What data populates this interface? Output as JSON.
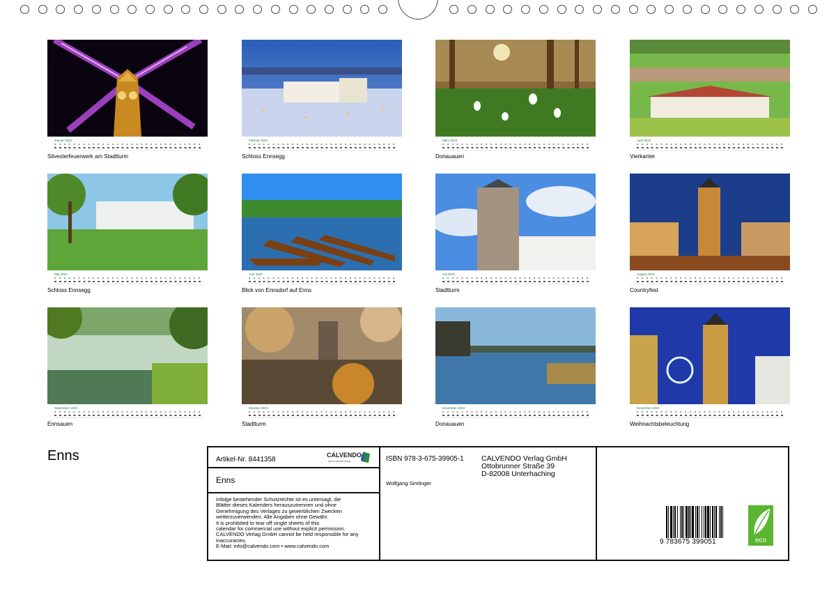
{
  "calendar_title": "Enns",
  "months": [
    {
      "month": "Januar 2023",
      "caption": "Silvesterfeuerwerk am Stadtturm"
    },
    {
      "month": "Februar 2023",
      "caption": "Schloss Ennsegg"
    },
    {
      "month": "März 2023",
      "caption": "Donauauen"
    },
    {
      "month": "April 2023",
      "caption": "Vierkanter"
    },
    {
      "month": "Mai 2023",
      "caption": "Schloss Ennsegg"
    },
    {
      "month": "Juni 2023",
      "caption": "Blick von Ennsdorf auf Enns"
    },
    {
      "month": "Juli 2023",
      "caption": "Stadtturm"
    },
    {
      "month": "August 2023",
      "caption": "Countryfest"
    },
    {
      "month": "September 2023",
      "caption": "Ennsauen"
    },
    {
      "month": "Oktober 2023",
      "caption": "Stadtturm"
    },
    {
      "month": "November 2023",
      "caption": "Donauauen"
    },
    {
      "month": "Dezember 2023",
      "caption": "Weihnachtsbeleuchtung"
    }
  ],
  "info": {
    "article": "Artikel-Nr. 8441358",
    "publisher_logo": "CALVENDO",
    "publisher_logo_sub": "Mein Kalenderverlag",
    "title": "Enns",
    "disclaimer_lines": [
      "Infolge bestehender Schutzrechte ist es untersagt, die",
      "Blätter dieses Kalenders herauszutrennen und ohne",
      "Genehmigung des Verlages zu gewerblichen Zwecken",
      "weiterzuverwenden. Alle Angaben ohne Gewähr.",
      "It is prohibited to tear off single sheets of this",
      "calendar for commercial use without explicit permission.",
      "CALVENDO Verlag GmbH cannot be held responsible for any",
      "inaccuracies.",
      "E-Mail: info@calvendo.com • www.calvendo.com"
    ],
    "isbn": "ISBN 978-3-675-39905-1",
    "author": "Wolfgang Simlinger",
    "publisher_lines": [
      "CALVENDO Verlag GmbH",
      "Ottobrunner Straße 39",
      "D-82008 Unterhaching"
    ],
    "barcode_number": "9 783675 399051",
    "eco_label": "eco"
  },
  "colors": {
    "month_label": "#1f7a3a",
    "eco_green": "#5cb531",
    "logo_green": "#2e8b3a"
  }
}
